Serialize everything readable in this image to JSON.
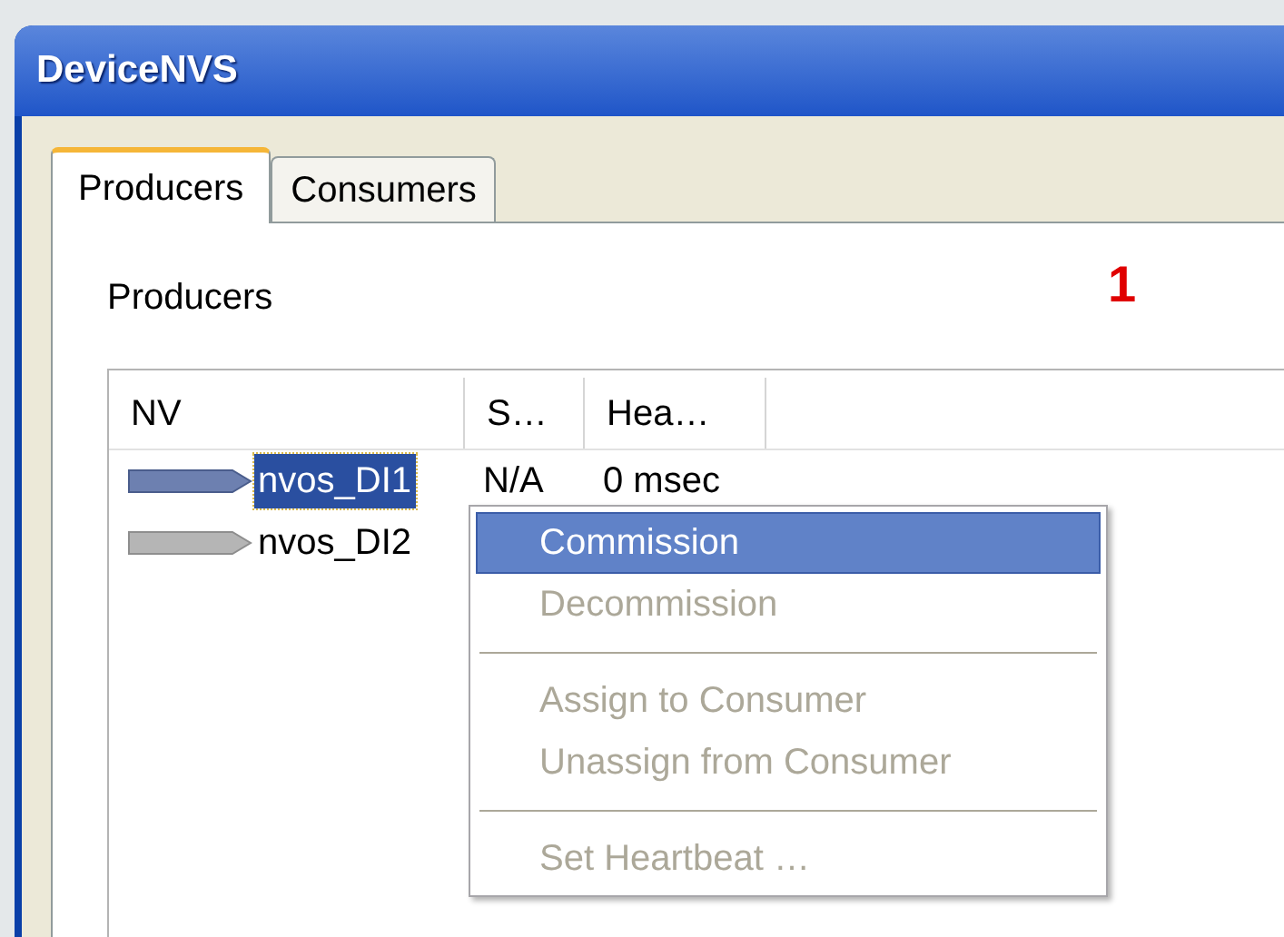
{
  "window": {
    "title": "DeviceNVS"
  },
  "tabs": [
    {
      "label": "Producers",
      "selected": true
    },
    {
      "label": "Consumers",
      "selected": false
    }
  ],
  "marker": "1",
  "section_label": "Producers",
  "table": {
    "columns": [
      "NV",
      "S…",
      "Hea…"
    ],
    "rows": [
      {
        "cells": [
          "nvos_DI1",
          "N/A",
          "0 msec"
        ],
        "selected": true
      },
      {
        "cells": [
          "nvos_DI2"
        ],
        "selected": false
      }
    ]
  },
  "context_menu": [
    {
      "kind": "item",
      "label": "Commission",
      "selected": true,
      "disabled": false
    },
    {
      "kind": "item",
      "label": "Decommission",
      "selected": false,
      "disabled": true
    },
    {
      "kind": "separator"
    },
    {
      "kind": "item",
      "label": "Assign to Consumer",
      "selected": false,
      "disabled": true
    },
    {
      "kind": "item",
      "label": "Unassign from Consumer",
      "selected": false,
      "disabled": true
    },
    {
      "kind": "separator"
    },
    {
      "kind": "item",
      "label": "Set Heartbeat …",
      "selected": false,
      "disabled": true
    }
  ]
}
